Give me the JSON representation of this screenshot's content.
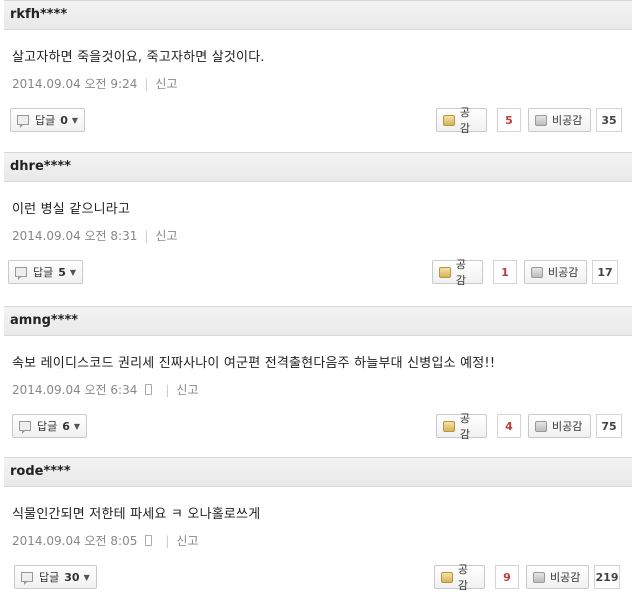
{
  "comments": [
    {
      "user": "rkfh****",
      "text": "살고자하면 죽을것이요, 죽고자하면 살것이다.",
      "date": "2014.09.04 오전 9:24",
      "report": "신고",
      "mobile": false,
      "reply_label": "답글",
      "reply_count": "0",
      "like_label": "공감",
      "likes": "5",
      "dislike_label": "비공감",
      "dislikes": "35"
    },
    {
      "user": "dhre****",
      "text": "이런 병실 같으니라고",
      "date": "2014.09.04 오전 8:31",
      "report": "신고",
      "mobile": false,
      "reply_label": "답글",
      "reply_count": "5",
      "like_label": "공감",
      "likes": "1",
      "dislike_label": "비공감",
      "dislikes": "17"
    },
    {
      "user": "amng****",
      "text": "속보 레이디스코드 권리세 진짜사나이 여군편 전격출현다음주 하늘부대 신병입소 예정!!",
      "date": "2014.09.04 오전 6:34",
      "report": "신고",
      "mobile": true,
      "reply_label": "답글",
      "reply_count": "6",
      "like_label": "공감",
      "likes": "4",
      "dislike_label": "비공감",
      "dislikes": "75"
    },
    {
      "user": "rode****",
      "text": "식물인간되면 저한테 파세요 ㅋ 오나홀로쓰게",
      "date": "2014.09.04 오전 8:05",
      "report": "신고",
      "mobile": true,
      "reply_label": "답글",
      "reply_count": "30",
      "like_label": "공감",
      "likes": "9",
      "dislike_label": "비공감",
      "dislikes": "219"
    }
  ]
}
